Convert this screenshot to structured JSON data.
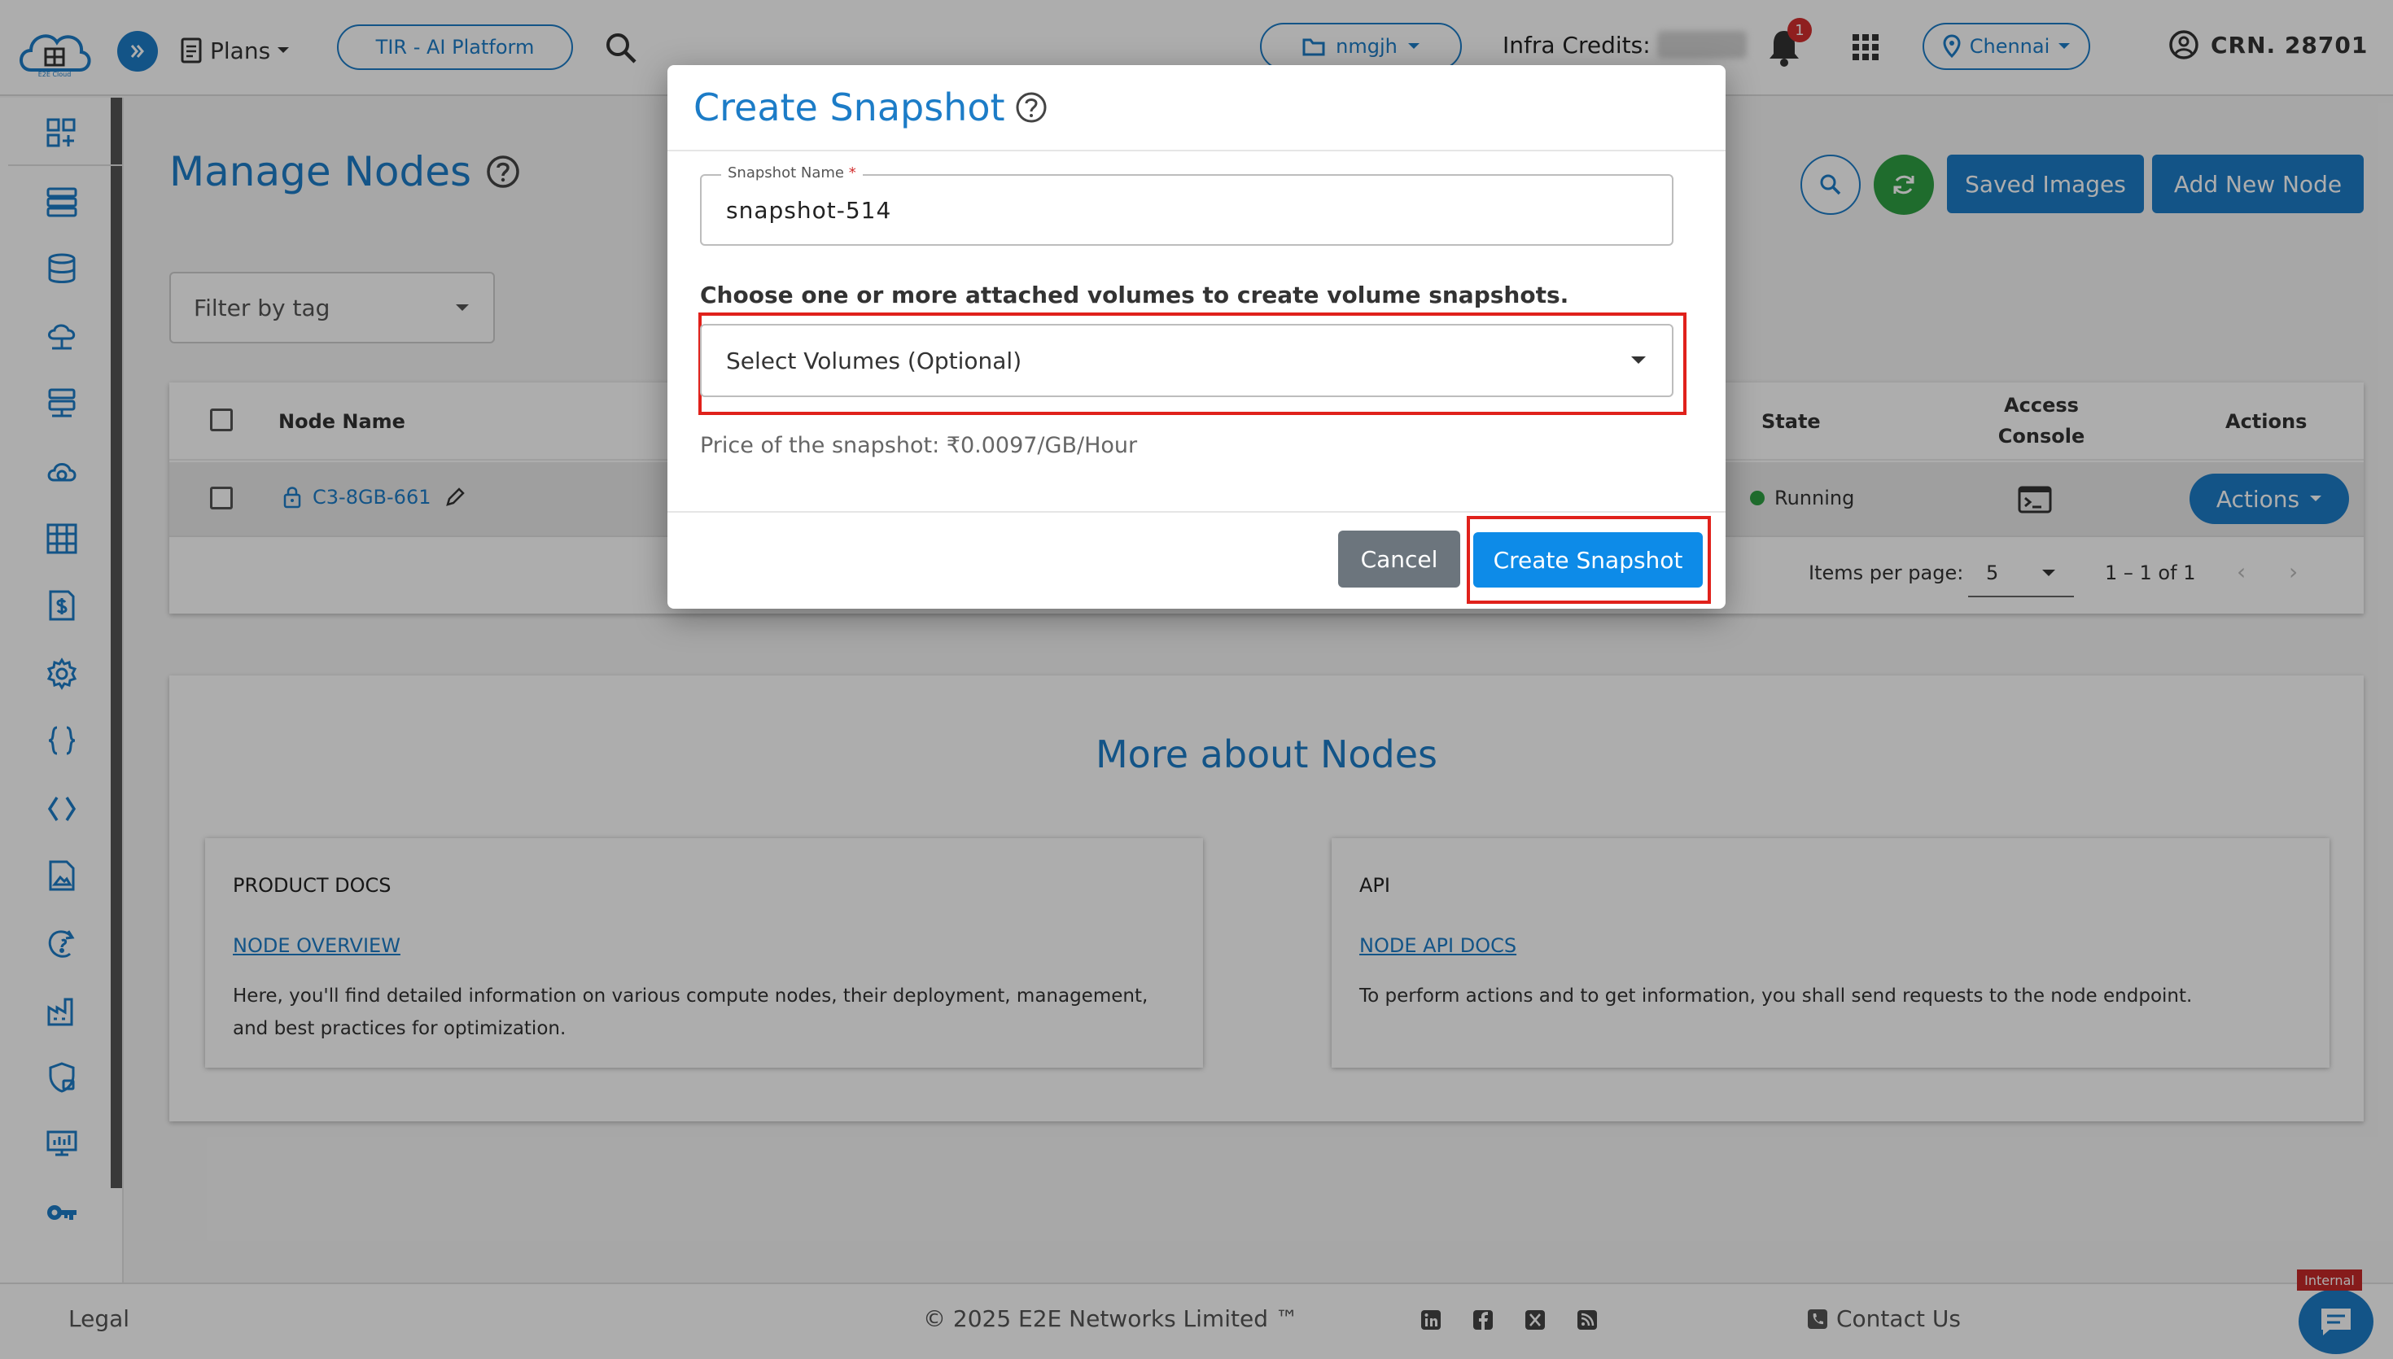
{
  "topbar": {
    "plans_label": "Plans",
    "platform_button": "TIR - AI Platform",
    "project_name": "nmgjh",
    "infra_credits_label": "Infra Credits:",
    "notification_count": "1",
    "location": "Chennai",
    "crn": "CRN. 28701"
  },
  "logo": {
    "caption": "E2E Cloud"
  },
  "page": {
    "title": "Manage Nodes",
    "filter_placeholder": "Filter by tag",
    "saved_images_button": "Saved Images",
    "add_node_button": "Add New Node"
  },
  "table": {
    "headers": {
      "node_name": "Node Name",
      "state": "State",
      "access_console_1": "Access",
      "access_console_2": "Console",
      "actions": "Actions"
    },
    "rows": [
      {
        "node_name": "C3-8GB-661",
        "state": "Running",
        "actions_label": "Actions"
      }
    ],
    "pagination": {
      "items_per_page_label": "Items per page:",
      "items_per_page": "5",
      "range": "1 – 1 of 1"
    }
  },
  "more": {
    "title": "More about Nodes",
    "cards": [
      {
        "label": "PRODUCT DOCS",
        "link": "NODE OVERVIEW",
        "description": "Here, you'll find detailed information on various compute nodes, their deployment, management, and best practices for optimization."
      },
      {
        "label": "API",
        "link": "NODE API DOCS",
        "description": "To perform actions and to get information, you shall send requests to the node endpoint."
      }
    ]
  },
  "footer": {
    "legal": "Legal",
    "copyright": "© 2025 E2E Networks Limited ™",
    "contact": "Contact Us",
    "internal_tag": "Internal"
  },
  "modal": {
    "title": "Create Snapshot",
    "snapshot_name_label": "Snapshot Name",
    "required_mark": "*",
    "snapshot_name_value": "snapshot-514",
    "volumes_hint": "Choose one or more attached volumes to create volume snapshots.",
    "volumes_placeholder": "Select Volumes (Optional)",
    "price_text": "Price of the snapshot: ₹0.0097/GB/Hour",
    "cancel_button": "Cancel",
    "create_button": "Create Snapshot"
  },
  "colors": {
    "accent": "#1c7cc7",
    "create_button": "#0d8be8",
    "highlight": "#e0211b",
    "running": "#2ea043",
    "cancel": "#6c757d"
  }
}
